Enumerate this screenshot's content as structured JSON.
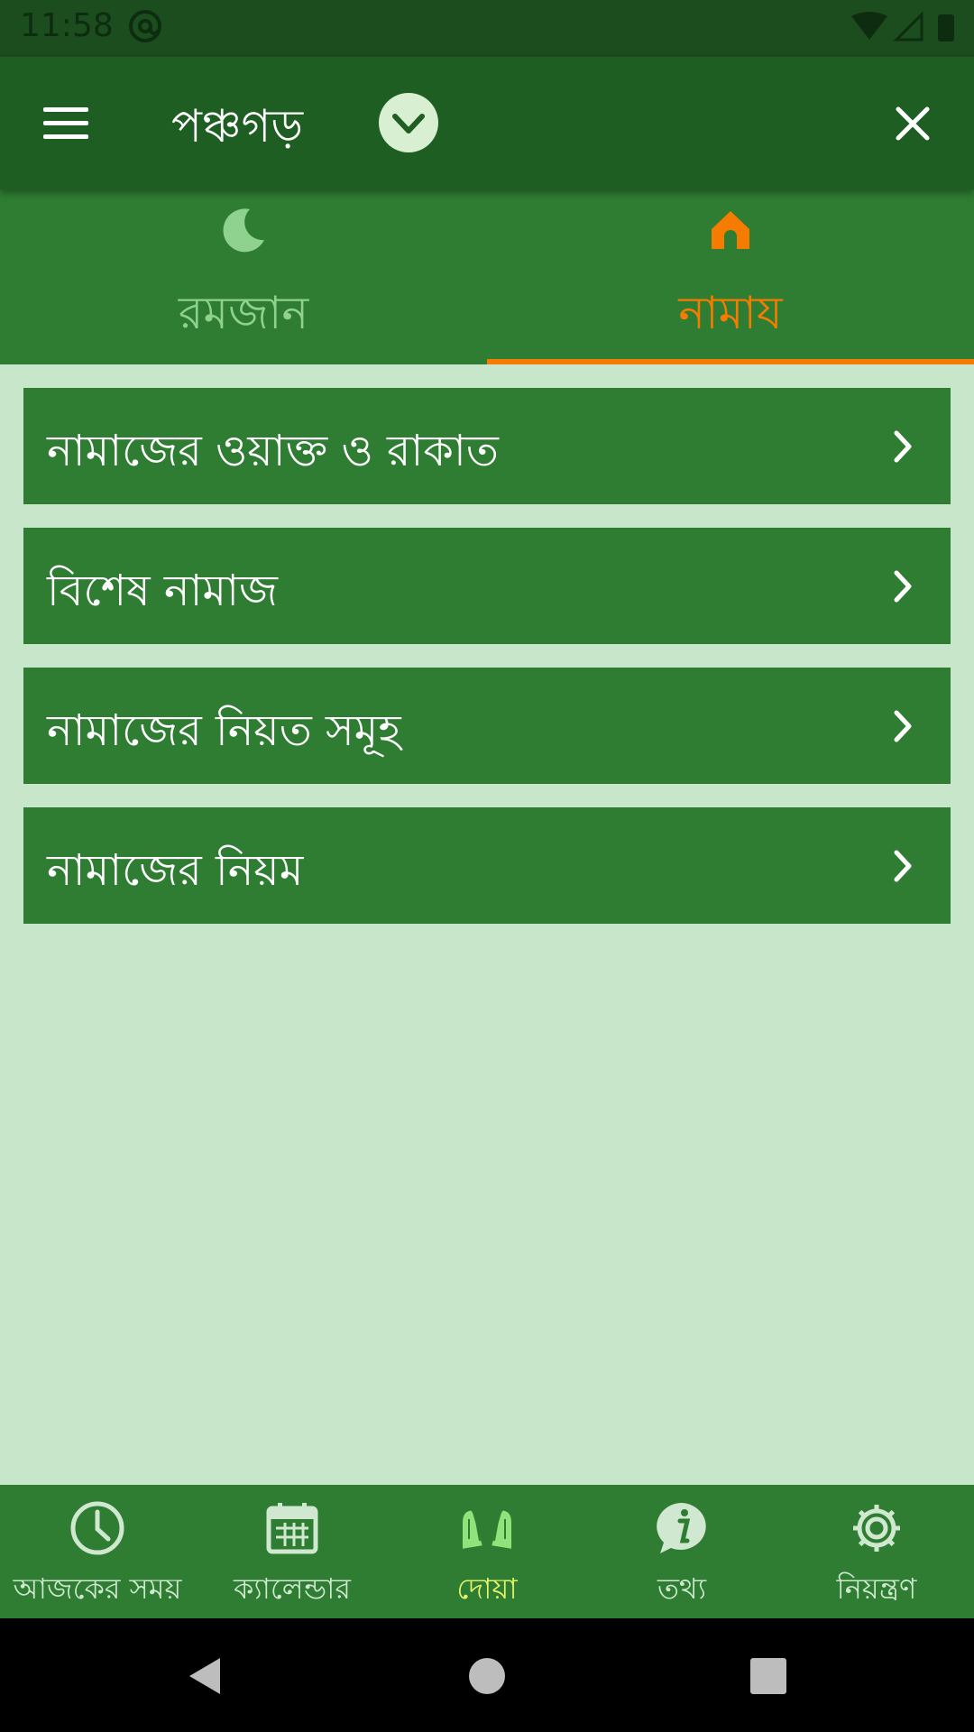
{
  "status_bar": {
    "time": "11:58"
  },
  "app_bar": {
    "title": "পঞ্চগড়"
  },
  "tabs": [
    {
      "label": "রমজান",
      "icon": "moon-icon",
      "active": false
    },
    {
      "label": "নামায",
      "icon": "mosque-icon",
      "active": true
    }
  ],
  "list": [
    {
      "label": "নামাজের ওয়াক্ত ও রাকাত"
    },
    {
      "label": "বিশেষ নামাজ"
    },
    {
      "label": "নামাজের নিয়ত সমূহ"
    },
    {
      "label": "নামাজের নিয়ম"
    }
  ],
  "bottom_nav": [
    {
      "label": "আজকের সময়",
      "icon": "clock-icon",
      "active": false
    },
    {
      "label": "ক্যালেন্ডার",
      "icon": "calendar-icon",
      "active": false
    },
    {
      "label": "দোয়া",
      "icon": "praying-hands-icon",
      "active": true
    },
    {
      "label": "তথ্য",
      "icon": "info-icon",
      "active": false
    },
    {
      "label": "নিয়ন্ত্রণ",
      "icon": "gear-icon",
      "active": false
    }
  ],
  "colors": {
    "primary_dark": "#1e5e22",
    "primary": "#2e7d32",
    "background": "#c8e6c9",
    "accent": "#f57c00",
    "active_nav": "#e8f56a",
    "inactive_tab": "#8fd18f"
  }
}
